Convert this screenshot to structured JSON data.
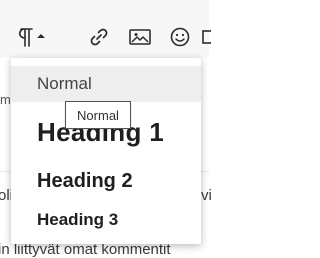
{
  "toolbar": {
    "paragraph_icon": "pilcrow-icon",
    "dropdown_caret_icon": "caret-down-icon",
    "link_icon": "link-icon",
    "image_icon": "image-icon",
    "emoji_icon": "emoji-icon"
  },
  "document": {
    "fragment_1": "m",
    "fragment_2": "oli",
    "fragment_2_right": "vi",
    "fragment_3": "in liittyvät omat kommentit"
  },
  "dropdown": {
    "items": [
      {
        "label": "Normal",
        "selected": true
      },
      {
        "label": "Heading 1"
      },
      {
        "label": "Heading 2"
      },
      {
        "label": "Heading 3"
      }
    ]
  },
  "tooltip": {
    "text": "Normal"
  }
}
